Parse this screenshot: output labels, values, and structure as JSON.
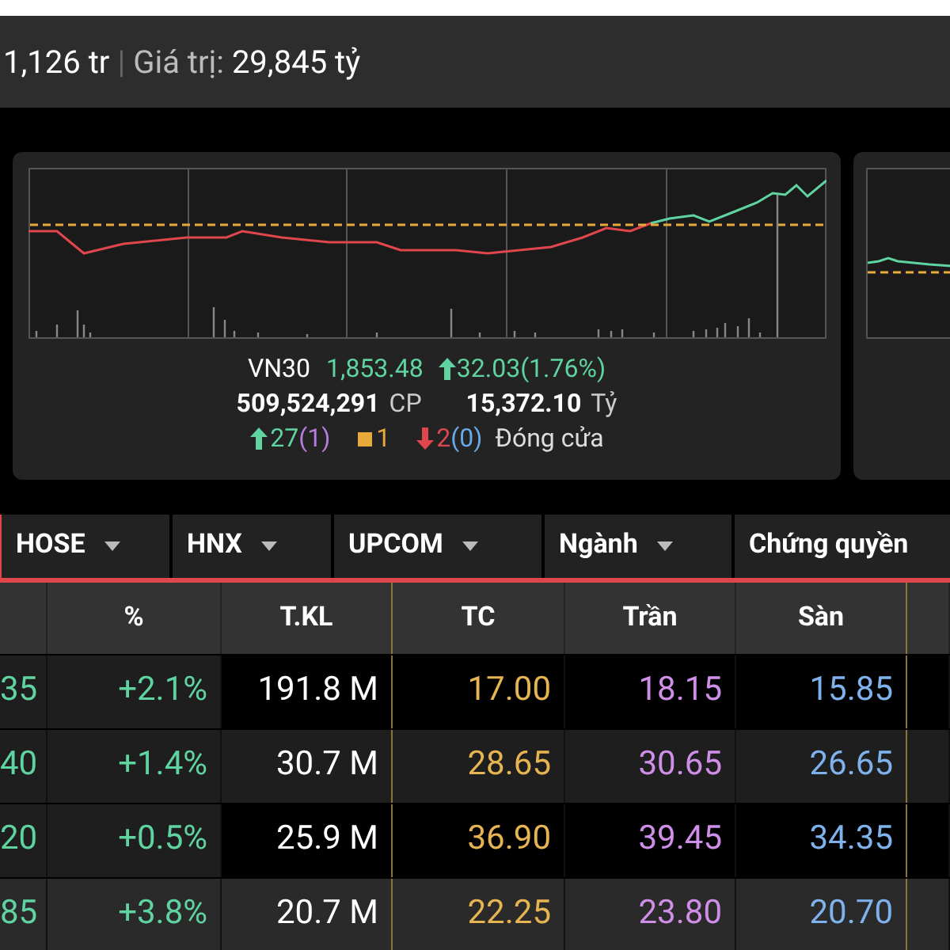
{
  "summary_bar": {
    "volume_value": "1,126 tr",
    "separator": "|",
    "value_label": "Giá trị:",
    "value_value": "29,845 tỷ"
  },
  "index_card": {
    "name": "VN30",
    "value": "1,853.48",
    "change": "32.03(1.76%)",
    "volume": "509,524,291",
    "volume_unit": "CP",
    "turnover": "15,372.10",
    "turnover_unit": "Tỷ",
    "breadth": [
      {
        "kind": "up",
        "count": "27",
        "sub": "(1)"
      },
      {
        "kind": "flat",
        "count": "1"
      },
      {
        "kind": "down",
        "count": "2",
        "sub": "(0)"
      }
    ],
    "status": "Đóng cửa"
  },
  "tabs": [
    {
      "label": "HOSE",
      "selected": false
    },
    {
      "label": "HNX",
      "selected": false
    },
    {
      "label": "UPCOM",
      "selected": false
    },
    {
      "label": "Ngành",
      "selected": false
    },
    {
      "label": "Chứng quyền",
      "selected": false
    }
  ],
  "table": {
    "columns": [
      "%",
      "T.KL",
      "TC",
      "Trần",
      "Sàn"
    ],
    "rows": [
      {
        "price": "35",
        "change": "+2.1%",
        "volume": "191.8 M",
        "ref": "17.00",
        "ceiling": "18.15",
        "floor": "15.85"
      },
      {
        "price": "40",
        "change": "+1.4%",
        "volume": "30.7 M",
        "ref": "28.65",
        "ceiling": "30.65",
        "floor": "26.65"
      },
      {
        "price": "20",
        "change": "+0.5%",
        "volume": "25.9 M",
        "ref": "36.90",
        "ceiling": "39.45",
        "floor": "34.35"
      },
      {
        "price": "85",
        "change": "+3.8%",
        "volume": "20.7 M",
        "ref": "22.25",
        "ceiling": "23.80",
        "floor": "20.70"
      }
    ]
  }
}
